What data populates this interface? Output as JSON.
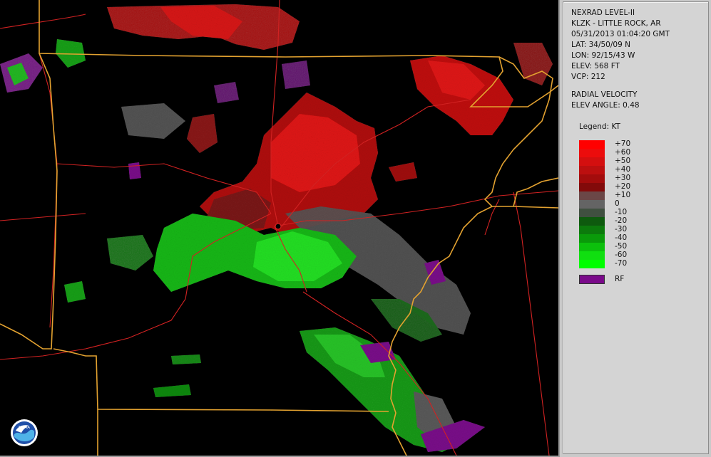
{
  "header": {
    "product": "NEXRAD LEVEL-II",
    "station": "KLZK - LITTLE ROCK, AR",
    "datetime": "05/31/2013 01:04:20 GMT",
    "lat": "LAT: 34/50/09 N",
    "lon": "LON: 92/15/43 W",
    "elev": "ELEV: 568 FT",
    "vcp": "VCP: 212"
  },
  "product_info": {
    "type": "RADIAL VELOCITY",
    "angle": "ELEV ANGLE: 0.48"
  },
  "legend": {
    "title": "Legend: KT",
    "entries": [
      {
        "label": "+70",
        "color": "#ff0000"
      },
      {
        "label": "+60",
        "color": "#ec0c0c"
      },
      {
        "label": "+50",
        "color": "#d40f0f"
      },
      {
        "label": "+40",
        "color": "#bc0f0f"
      },
      {
        "label": "+30",
        "color": "#a30c0c"
      },
      {
        "label": "+20",
        "color": "#820a0a"
      },
      {
        "label": "+10",
        "color": "#6b4747"
      },
      {
        "label": "0",
        "color": "#646464"
      },
      {
        "label": "-10",
        "color": "#405040"
      },
      {
        "label": "-20",
        "color": "#0e5a0e"
      },
      {
        "label": "-30",
        "color": "#0c7a0c"
      },
      {
        "label": "-40",
        "color": "#0a9a0a"
      },
      {
        "label": "-50",
        "color": "#0cc00c"
      },
      {
        "label": "-60",
        "color": "#10df10"
      },
      {
        "label": "-70",
        "color": "#00ff00"
      }
    ],
    "rf": {
      "label": "RF",
      "color": "#7a0a8a"
    }
  },
  "colors": {
    "state_border": "#e3a230",
    "county_road": "#d12222",
    "background": "#000000"
  },
  "logo": {
    "name": "noaa-logo",
    "text": "NOAA"
  }
}
